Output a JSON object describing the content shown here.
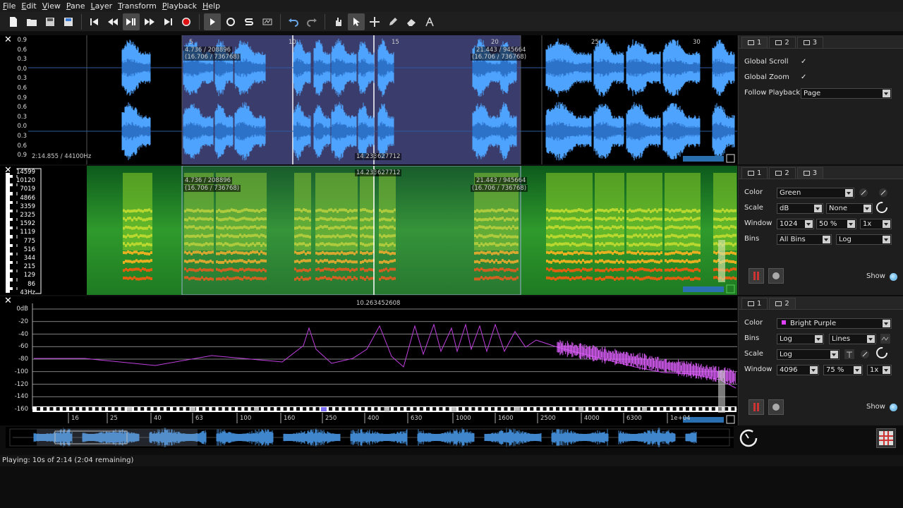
{
  "menu": [
    {
      "first": "F",
      "rest": "ile"
    },
    {
      "first": "E",
      "rest": "dit"
    },
    {
      "first": "V",
      "rest": "iew"
    },
    {
      "first": "P",
      "rest": "ane"
    },
    {
      "first": "L",
      "rest": "ayer"
    },
    {
      "first": "T",
      "rest": "ransform"
    },
    {
      "first": "P",
      "rest": "layback"
    },
    {
      "first": "H",
      "rest": "elp"
    }
  ],
  "toolbar": {
    "buttons": [
      "new-file-icon",
      "open-folder-icon",
      "save-icon",
      "save-as-icon",
      "rewind-start-icon",
      "rewind-icon",
      "play-pause-icon",
      "fast-forward-icon",
      "forward-end-icon",
      "record-icon",
      "play-selection-icon",
      "loop-icon",
      "solo-icon",
      "normalize-icon",
      "undo-icon",
      "redo-icon",
      "navigate-hand-icon",
      "select-arrow-icon",
      "edit-cross-icon",
      "draw-pencil-icon",
      "erase-icon",
      "measure-icon"
    ]
  },
  "waveform": {
    "ruler": [
      "5",
      "10",
      "15",
      "20",
      "25",
      "30"
    ],
    "ticks": [
      "0.9",
      "0.6",
      "0.3",
      "0.0",
      "0.3",
      "0.6",
      "0.9",
      "0.6",
      "0.3",
      "0.0",
      "0.3",
      "0.6",
      "0.9"
    ],
    "sel_start": "4.736 / 208896",
    "sel_start2": "(16.706 / 736768)",
    "sel_end": "21.443 / 945664",
    "sel_end2": "(16.706 / 736768)",
    "cursor": "14.233",
    "cursor_frame": "627712",
    "info": "2:14.855 / 44100Hz",
    "colors": {
      "wave": "#4ea3ff",
      "selection": "#3a3c6c"
    }
  },
  "spectrogram": {
    "ticks": [
      "14599",
      "10120",
      "7019",
      "4866",
      "3359",
      "2325",
      "1592",
      "1119",
      "775",
      "516",
      "344",
      "215",
      "129",
      "86",
      "43Hz"
    ],
    "sel_start": "4.736 / 208896",
    "sel_start2": "(16.706 / 736768)",
    "sel_end": "21.443 / 945664",
    "sel_end2": "(16.706 / 736768)",
    "cursor": "14.233",
    "cursor_frame": "627712"
  },
  "spectrum": {
    "yticks": [
      "0dB",
      "-20",
      "-40",
      "-60",
      "-80",
      "-100",
      "-120",
      "-140",
      "-160"
    ],
    "xticks": [
      "16",
      "25",
      "40",
      "63",
      "100",
      "160",
      "250",
      "400",
      "630",
      "1000",
      "1600",
      "2500",
      "4000",
      "6300",
      "1e+04"
    ],
    "cursor": "10.263",
    "cursor_frame": "452608",
    "colors": {
      "line": "#c040e0",
      "highlight": "#e060ff"
    }
  },
  "panel1": {
    "tabs": [
      "1",
      "2",
      "3"
    ],
    "global_scroll_label": "Global Scroll",
    "global_scroll": "✓",
    "global_zoom_label": "Global Zoom",
    "global_zoom": "✓",
    "follow_label": "Follow Playback",
    "follow_value": "Page"
  },
  "panel2": {
    "tabs": [
      "1",
      "2",
      "3"
    ],
    "color_label": "Color",
    "color_value": "Green",
    "scale_label": "Scale",
    "scale_value": "dB",
    "scale_norm": "None",
    "window_label": "Window",
    "window_size": "1024",
    "window_overlap": "50 %",
    "window_zoom": "1x",
    "bins_label": "Bins",
    "bins_value": "All Bins",
    "bins_freq": "Log",
    "show_label": "Show"
  },
  "panel3": {
    "tabs": [
      "1",
      "2"
    ],
    "color_label": "Color",
    "color_value": "Bright Purple",
    "bins_label": "Bins",
    "bins_value": "Log",
    "bins_plot": "Lines",
    "scale_label": "Scale",
    "scale_value": "Log",
    "window_label": "Window",
    "window_size": "4096",
    "window_overlap": "75 %",
    "window_zoom": "1x",
    "show_label": "Show"
  },
  "status": "Playing: 10s of 2:14 (2:04 remaining)"
}
